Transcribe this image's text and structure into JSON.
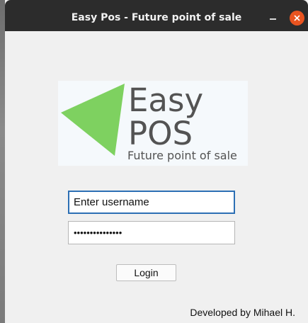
{
  "window": {
    "title": "Easy Pos - Future point of sale"
  },
  "logo": {
    "main_text": "Easy POS",
    "main_line1": "Easy",
    "main_line2": "POS",
    "tagline": "Future point of sale",
    "triangle_color": "#7ed160"
  },
  "login_form": {
    "username_value": "Enter username",
    "password_value": "•••••••••••••••",
    "login_label": "Login"
  },
  "footer": {
    "credit": "Developed by Mihael H."
  },
  "colors": {
    "titlebar": "#2c2c2c",
    "close_button": "#e95420",
    "focus_border": "#2c6fb4",
    "window_bg": "#f0f0f0"
  }
}
